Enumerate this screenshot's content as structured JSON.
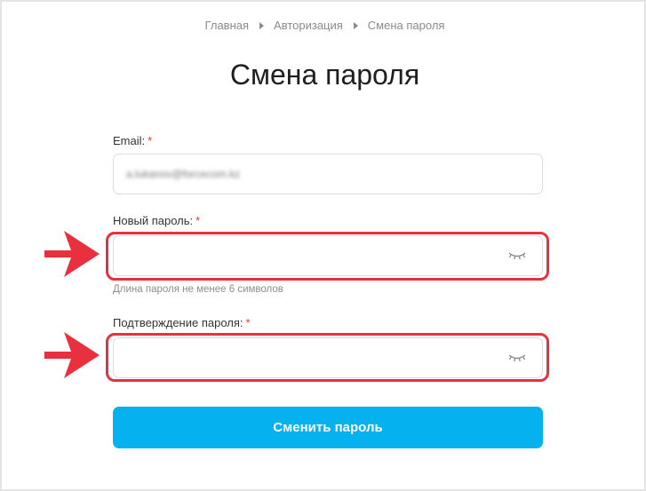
{
  "breadcrumb": {
    "items": [
      "Главная",
      "Авторизация",
      "Смена пароля"
    ]
  },
  "page": {
    "title": "Смена пароля"
  },
  "form": {
    "email": {
      "label": "Email:",
      "required_mark": "*",
      "value": "a.lukanov@forcecom.kz"
    },
    "new_password": {
      "label": "Новый пароль:",
      "required_mark": "*",
      "value": "",
      "icon": "eye-closed-icon",
      "hint": "Длина пароля не менее 6 символов"
    },
    "confirm_password": {
      "label": "Подтверждение пароля:",
      "required_mark": "*",
      "value": "",
      "icon": "eye-closed-icon"
    },
    "submit_label": "Сменить пароль"
  },
  "annotation": {
    "highlight_color": "#e8303f",
    "arrow_color": "#e8303f"
  },
  "colors": {
    "accent": "#05b1ee",
    "required": "#e8382f",
    "text": "#1f1f1f"
  }
}
